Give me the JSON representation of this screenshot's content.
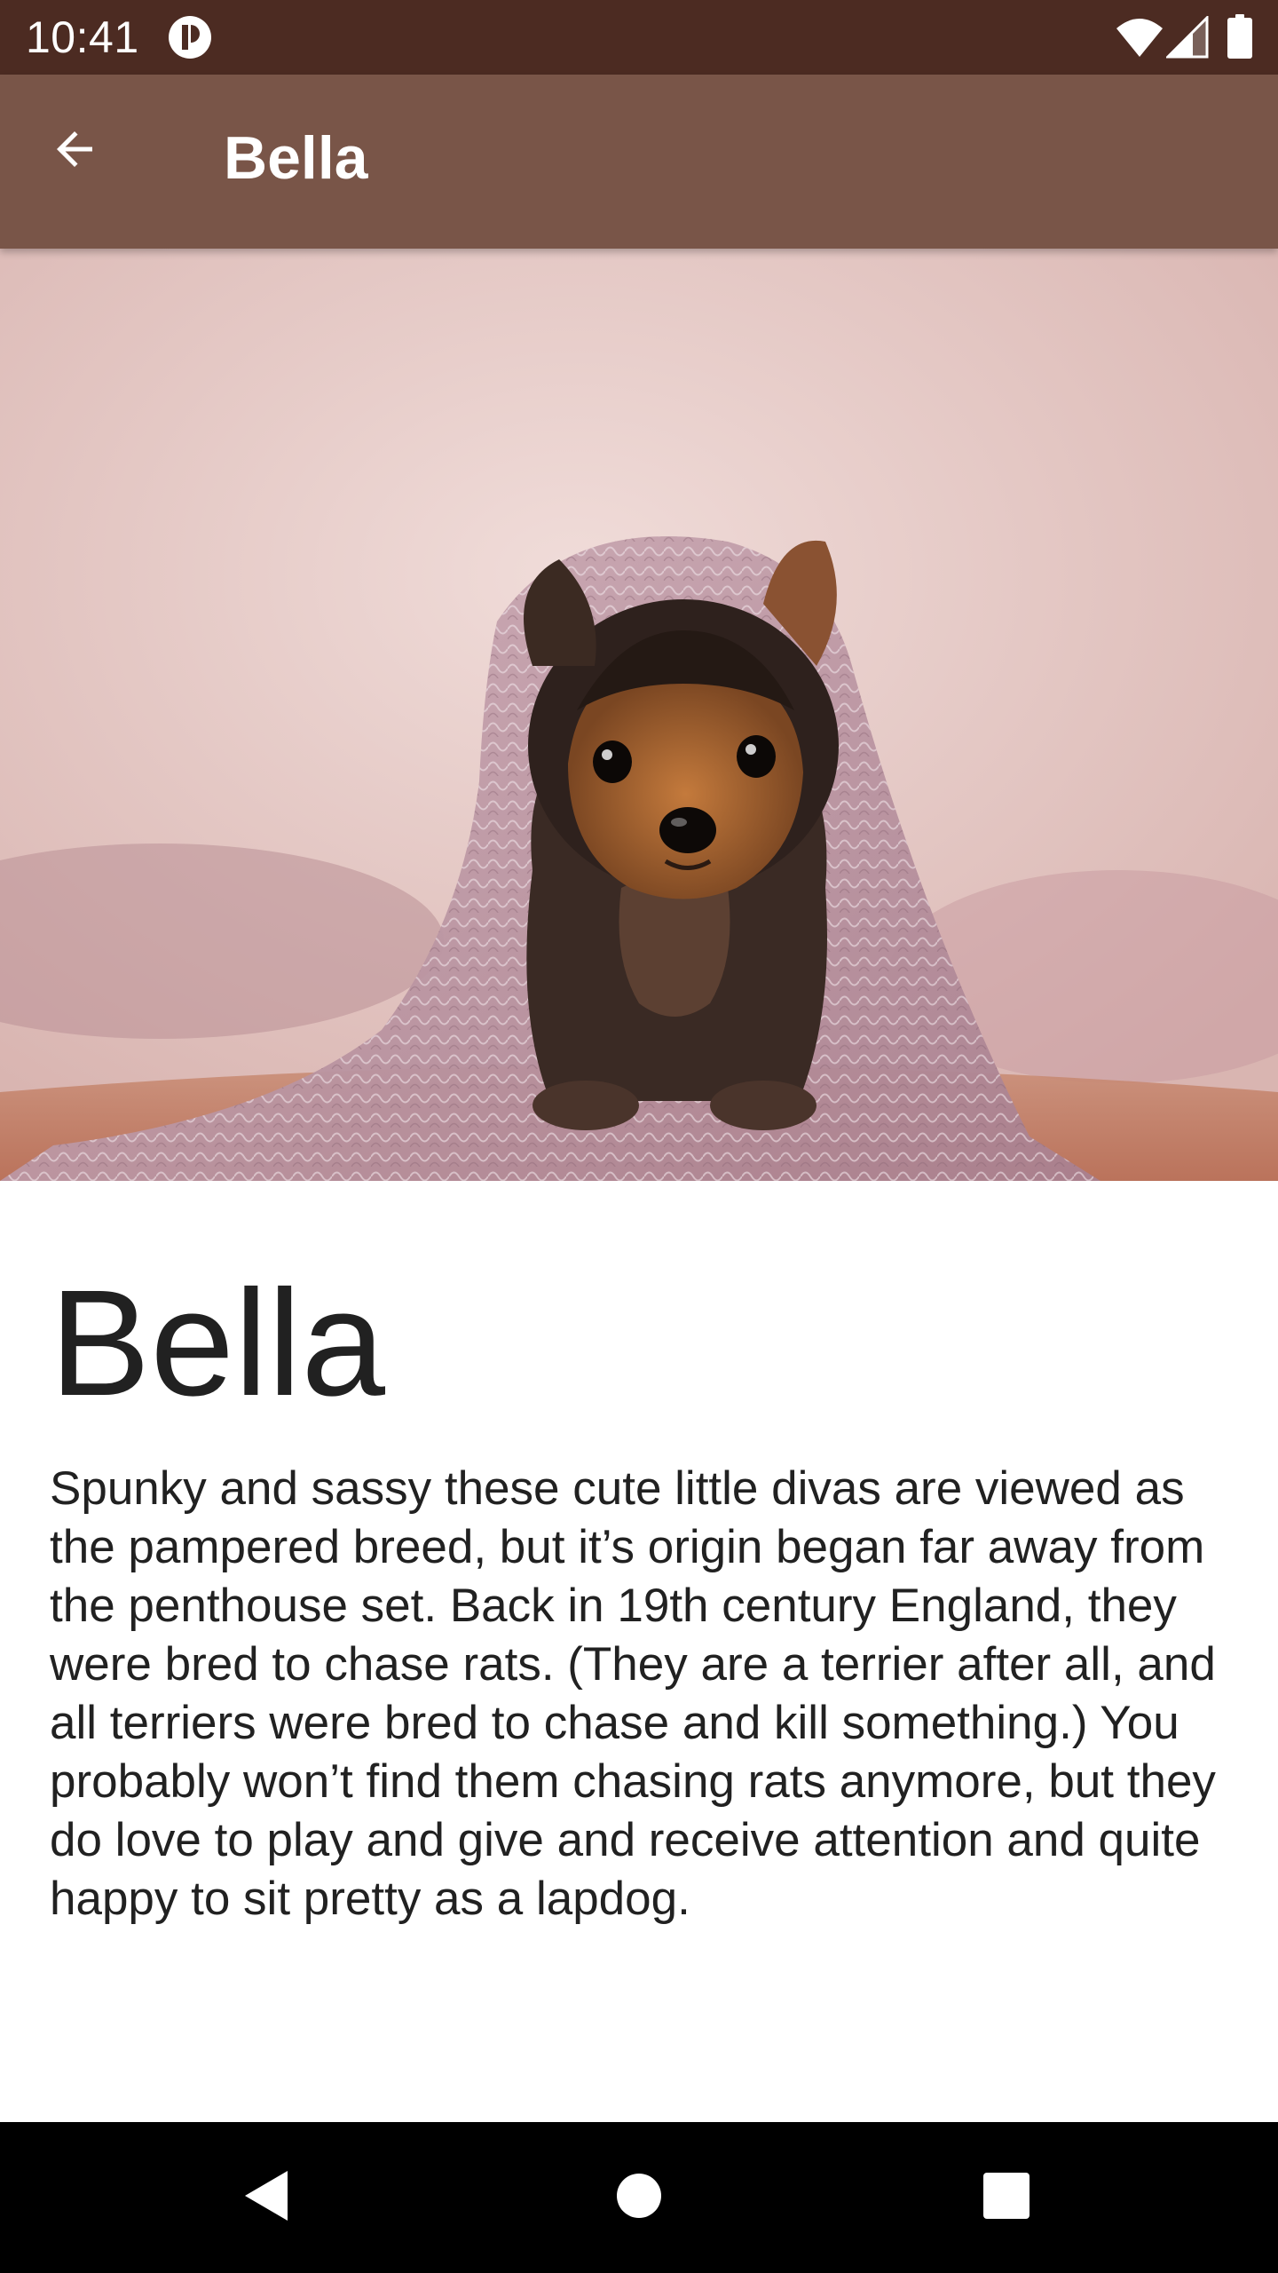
{
  "status_bar": {
    "time": "10:41",
    "icons": [
      "app-notification-icon",
      "wifi-icon",
      "cell-signal-icon",
      "battery-icon"
    ]
  },
  "app_bar": {
    "back_icon": "arrow-back-icon",
    "title": "Bella"
  },
  "hero": {
    "image": "yorkshire-terrier-puppy-under-knit-blanket"
  },
  "content": {
    "name": "Bella",
    "description": "Spunky and sassy these cute little divas are viewed as the pampered breed, but it’s origin began far away from the penthouse set. Back in 19th century England, they were bred to chase rats. (They are a terrier after all, and all terriers were bred to chase and kill something.) You probably won’t find them chasing rats anymore, but they do love to play and give and receive attention and quite happy to sit pretty as a lapdog."
  },
  "nav_bar": {
    "icons": [
      "nav-back-icon",
      "nav-home-icon",
      "nav-recents-icon"
    ]
  },
  "colors": {
    "status_bar": "#4c2b22",
    "app_bar": "#795548",
    "text_primary": "#212121",
    "nav_bar": "#000000"
  }
}
